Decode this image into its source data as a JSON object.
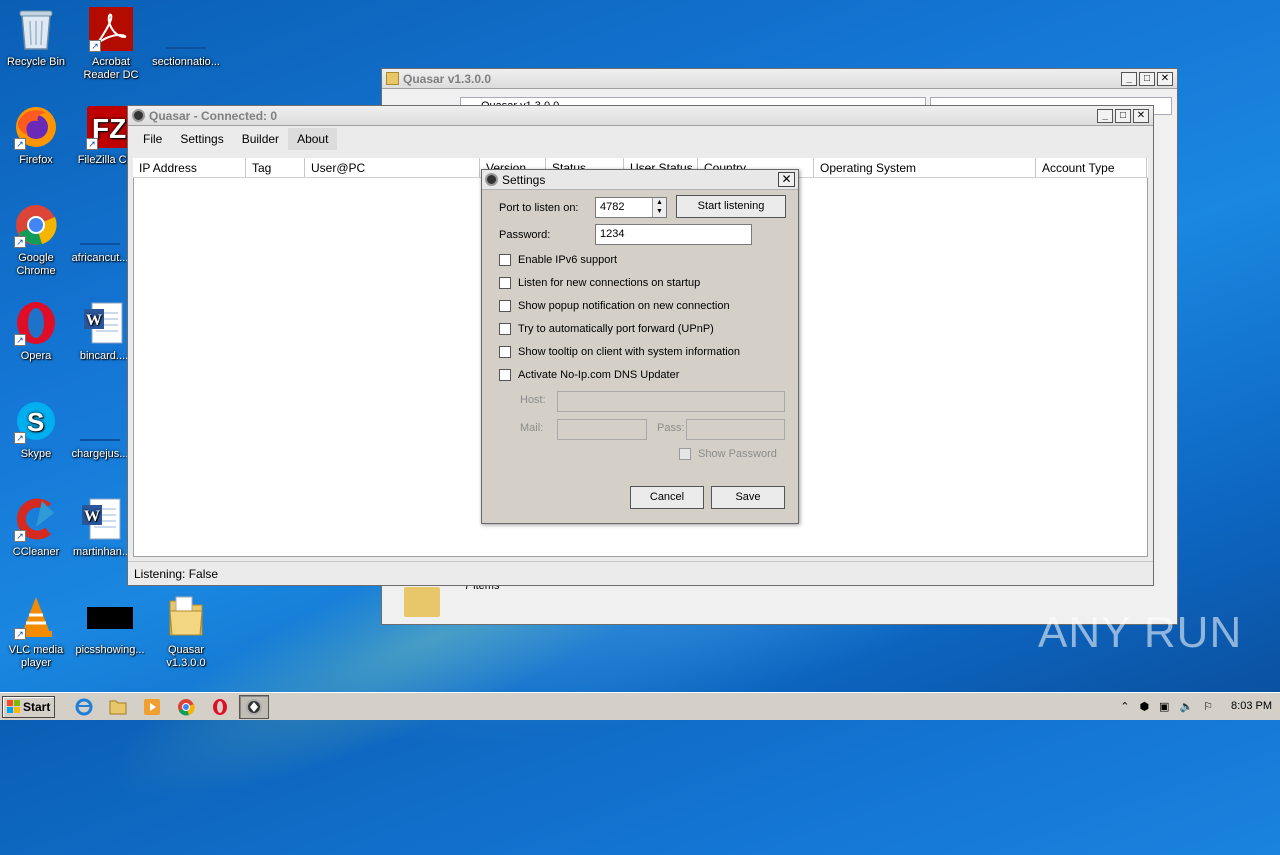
{
  "desktop": {
    "icons": [
      {
        "label": "Recycle Bin"
      },
      {
        "label": "Acrobat Reader DC"
      },
      {
        "label": "sectionnatio..."
      },
      {
        "label": "Firefox"
      },
      {
        "label": "FileZilla Cl..."
      },
      {
        "label": "Google Chrome"
      },
      {
        "label": "africancut..."
      },
      {
        "label": "Opera"
      },
      {
        "label": "bincard...."
      },
      {
        "label": "Skype"
      },
      {
        "label": "chargejus..."
      },
      {
        "label": "CCleaner"
      },
      {
        "label": "martinhan..."
      },
      {
        "label": "VLC media player"
      },
      {
        "label": "picsshowing..."
      },
      {
        "label": "Quasar v1.3.0.0"
      }
    ]
  },
  "explorer_window": {
    "title": "Quasar v1.3.0.0",
    "path_fragment": "Quasar v1.3.0.0",
    "items_fragment": "7 items"
  },
  "quasar_window": {
    "title": "Quasar - Connected: 0",
    "menu": [
      "File",
      "Settings",
      "Builder",
      "About"
    ],
    "columns": [
      "IP Address",
      "Tag",
      "User@PC",
      "Version",
      "Status",
      "User Status",
      "Country",
      "Operating System",
      "Account Type"
    ],
    "status": "Listening: False"
  },
  "settings_dialog": {
    "title": "Settings",
    "port_label": "Port to listen on:",
    "port_value": "4782",
    "start_button": "Start listening",
    "password_label": "Password:",
    "password_value": "1234",
    "options": [
      "Enable IPv6 support",
      "Listen for new connections on startup",
      "Show popup notification on new connection",
      "Try to automatically port forward (UPnP)",
      "Show tooltip on client with system information",
      "Activate No-Ip.com DNS Updater"
    ],
    "host_label": "Host:",
    "mail_label": "Mail:",
    "pass_label": "Pass:",
    "show_password": "Show Password",
    "cancel": "Cancel",
    "save": "Save"
  },
  "taskbar": {
    "start": "Start",
    "clock": "8:03 PM"
  },
  "watermark": "ANY RUN"
}
